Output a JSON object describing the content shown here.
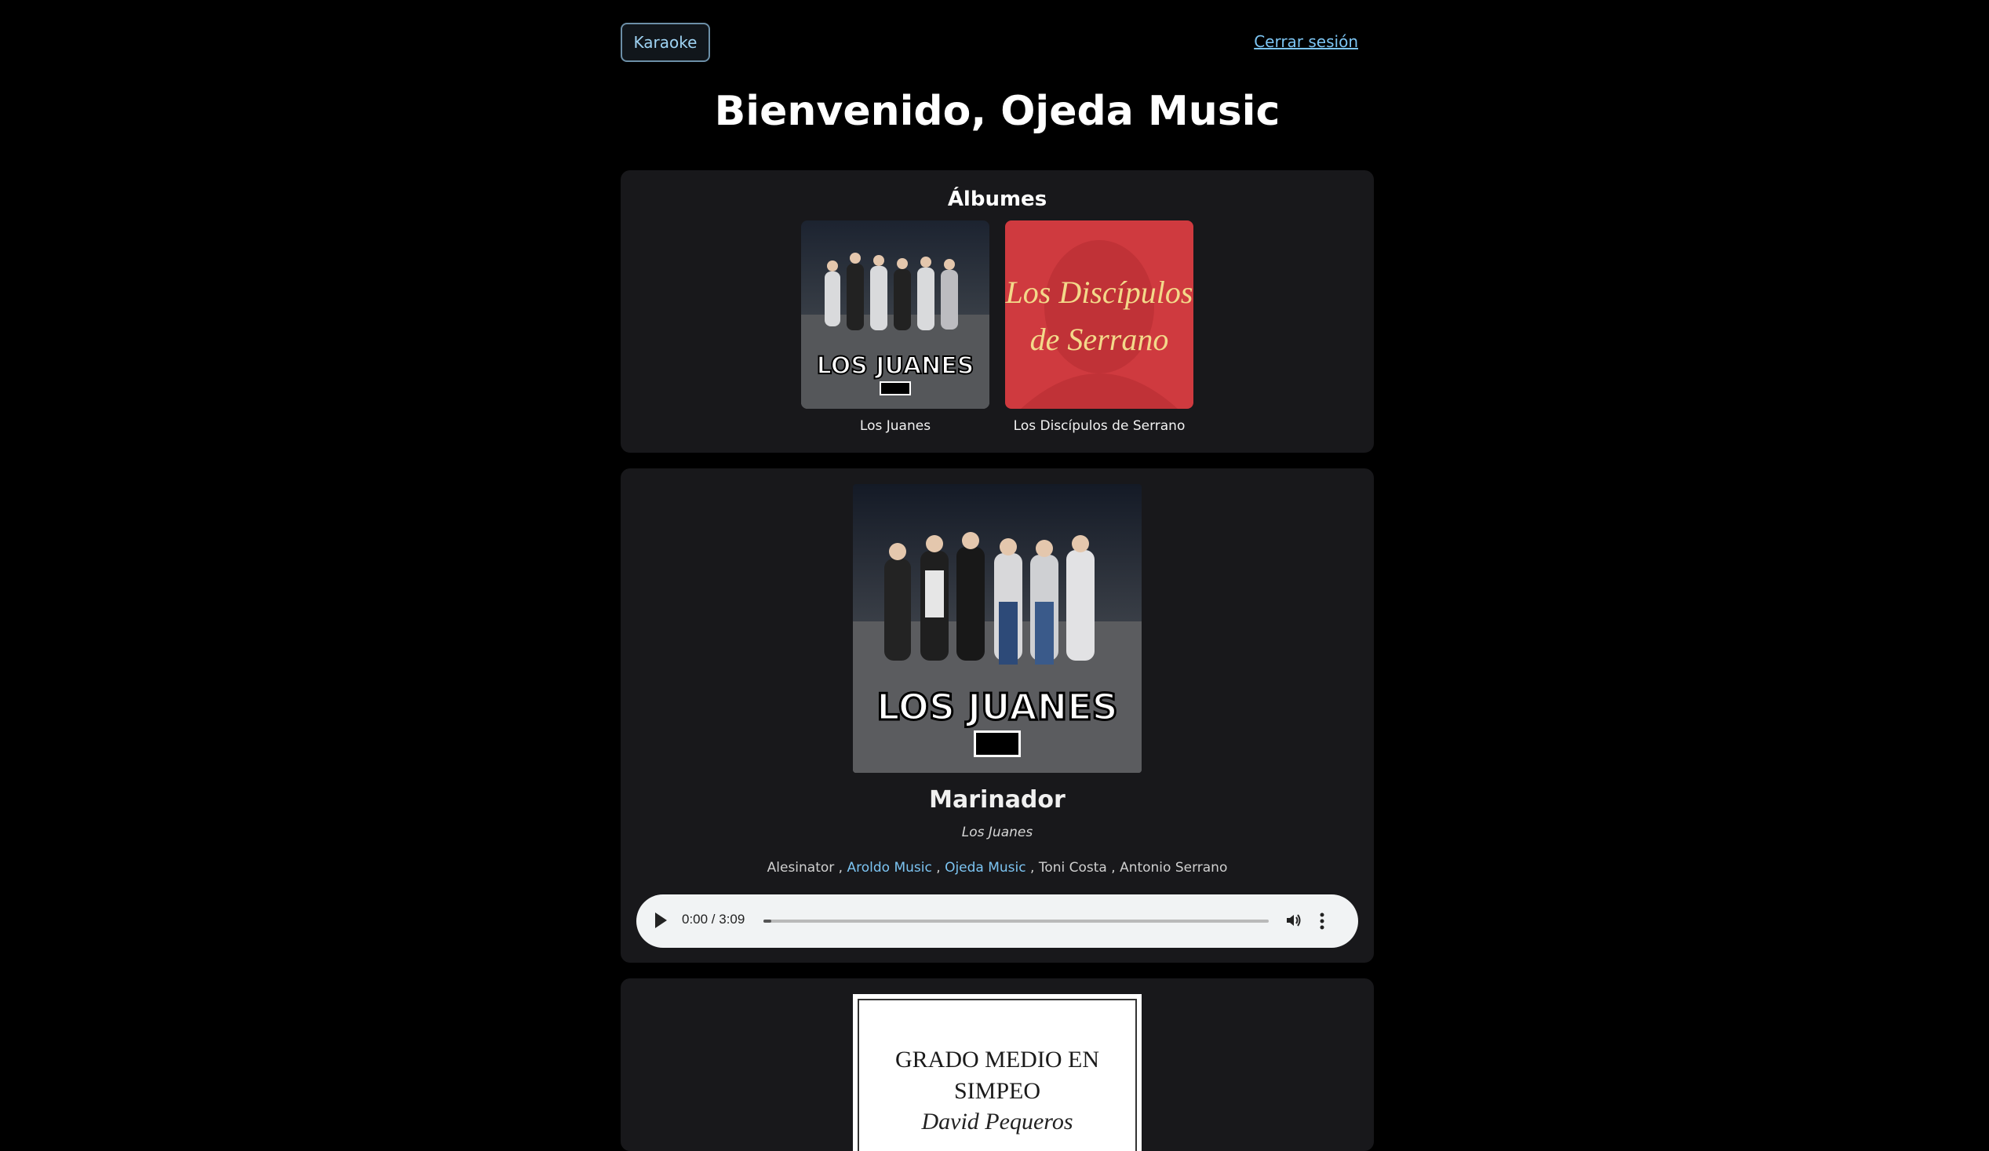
{
  "header": {
    "karaoke_label": "Karaoke",
    "logout_label": "Cerrar sesión",
    "title": "Bienvenido, Ojeda Music"
  },
  "albums": {
    "title": "Álbumes",
    "items": [
      {
        "name": "Los Juanes",
        "cover_text": "LOS JUANES"
      },
      {
        "name": "Los Discípulos de Serrano",
        "cover_text_1": "Los Discípulos",
        "cover_text_2": "de Serrano"
      }
    ]
  },
  "song": {
    "title": "Marinador",
    "album": "Los Juanes",
    "cover_text": "LOS JUANES",
    "artists": [
      {
        "name": "Alesinator",
        "link": false
      },
      {
        "name": "Aroldo Music",
        "link": true
      },
      {
        "name": "Ojeda Music",
        "link": true
      },
      {
        "name": "Toni Costa",
        "link": false
      },
      {
        "name": "Antonio Serrano",
        "link": false
      }
    ],
    "player": {
      "time": "0:00 / 3:09",
      "progress": 0
    }
  },
  "next_song": {
    "cover_line_1": "GRADO MEDIO EN",
    "cover_line_2": "SIMPEO",
    "cover_line_3": "David Pequeros"
  },
  "colors": {
    "background": "#000000",
    "card": "#18181b",
    "link": "#7cc4f2",
    "album2_red": "#cf3a3f"
  }
}
